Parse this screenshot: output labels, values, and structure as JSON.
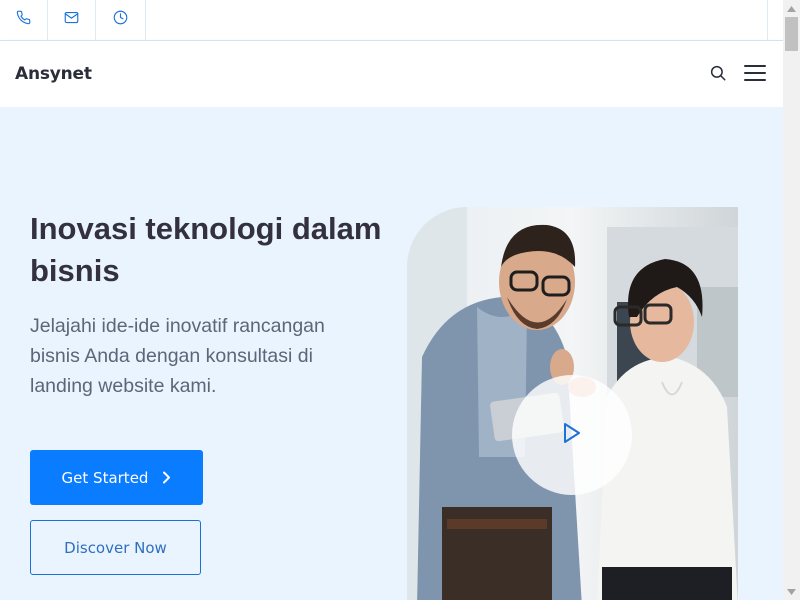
{
  "topbar": {
    "items": [
      {
        "icon": "phone-icon"
      },
      {
        "icon": "mail-icon"
      },
      {
        "icon": "clock-icon"
      }
    ]
  },
  "navbar": {
    "brand": "Ansynet",
    "search_icon": "search-icon",
    "menu_icon": "hamburger-menu-icon"
  },
  "hero": {
    "title": "Inovasi teknologi dalam bisnis",
    "subtitle": "Jelajahi ide-ide inovatif rancangan bisnis Anda dengan konsultasi di landing website kami.",
    "primary_button": "Get Started",
    "secondary_button": "Discover Now",
    "play_icon": "play-icon"
  },
  "colors": {
    "accent": "#0a7cff",
    "hero_bg": "#eaf4ff",
    "title": "#33303f",
    "subtitle": "#5e6577",
    "icon": "#1d72d8"
  }
}
